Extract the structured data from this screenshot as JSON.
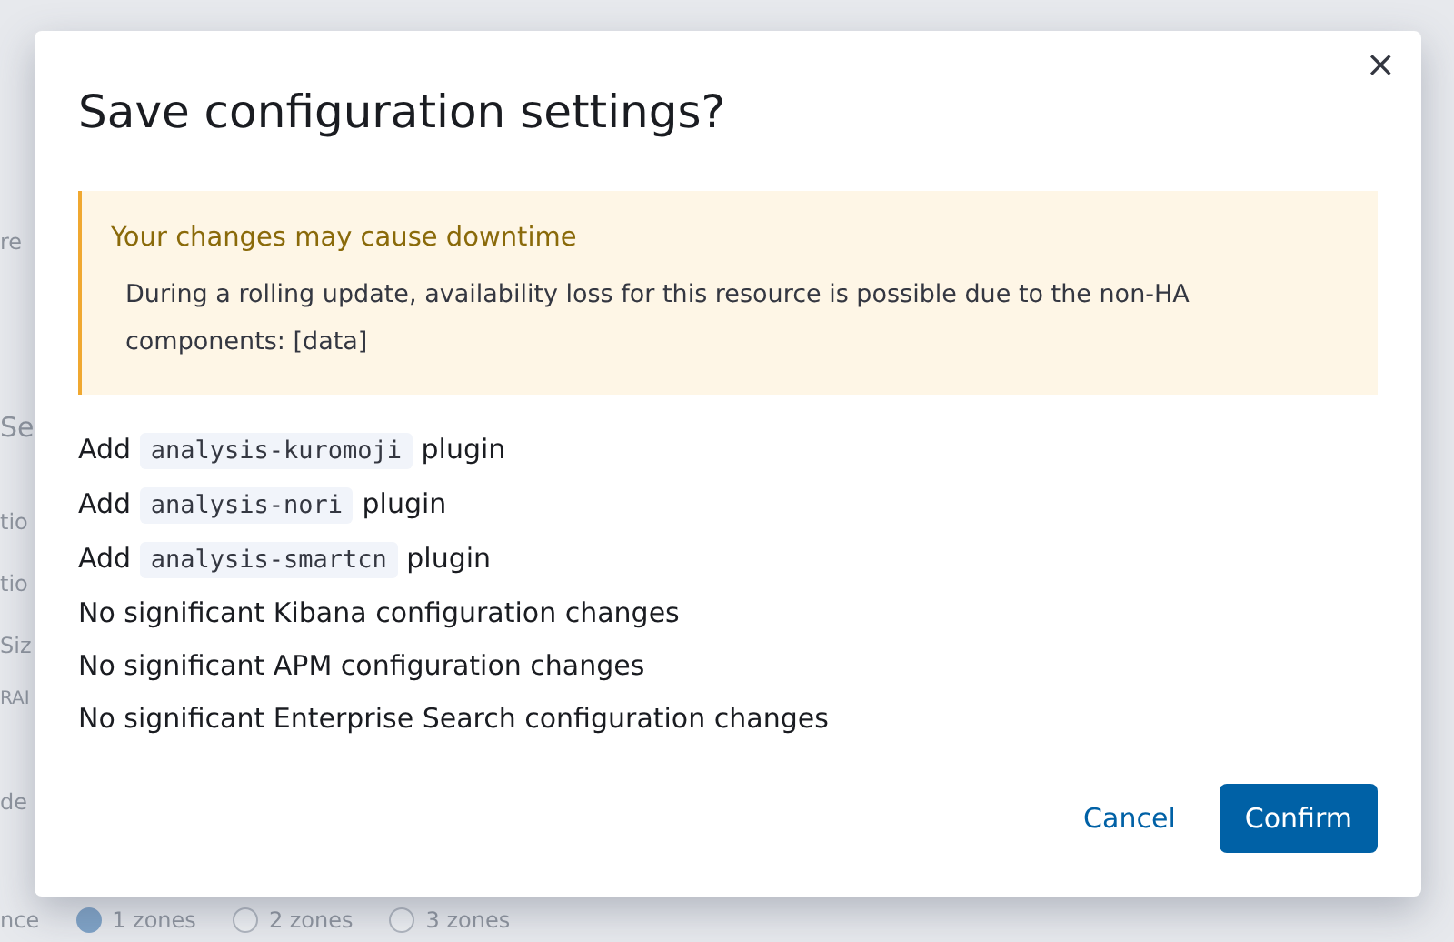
{
  "background": {
    "fragments": [
      "re",
      "Se",
      "tio",
      "tio",
      "Siz",
      "RAI",
      "de"
    ],
    "availability_label": "nce",
    "zones": [
      {
        "label": "1 zones",
        "selected": true
      },
      {
        "label": "2 zones",
        "selected": false
      },
      {
        "label": "3 zones",
        "selected": false
      }
    ]
  },
  "modal": {
    "title": "Save configuration settings?",
    "close": "×",
    "callout": {
      "title": "Your changes may cause downtime",
      "body": "During a rolling update, availability loss for this resource is possible due to the non-HA components: [data]"
    },
    "changes": [
      {
        "kind": "plugin",
        "prefix": "Add",
        "code": "analysis-kuromoji",
        "suffix": "plugin"
      },
      {
        "kind": "plugin",
        "prefix": "Add",
        "code": "analysis-nori",
        "suffix": "plugin"
      },
      {
        "kind": "plugin",
        "prefix": "Add",
        "code": "analysis-smartcn",
        "suffix": "plugin"
      },
      {
        "kind": "text",
        "text": "No significant Kibana configuration changes"
      },
      {
        "kind": "text",
        "text": "No significant APM configuration changes"
      },
      {
        "kind": "text",
        "text": "No significant Enterprise Search configuration changes"
      }
    ],
    "buttons": [
      {
        "kind": "link",
        "label": "Cancel"
      },
      {
        "kind": "primary",
        "label": "Confirm"
      }
    ]
  }
}
